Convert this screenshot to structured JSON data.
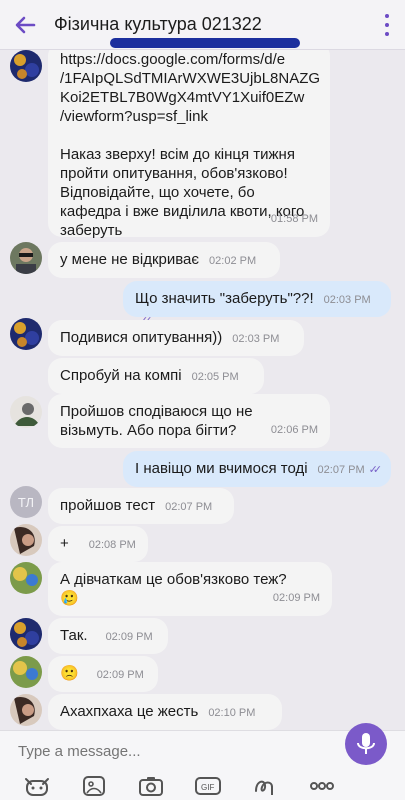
{
  "header": {
    "title": "Фізична культура 021322"
  },
  "messages": [
    {
      "text": "https://docs.google.com/forms/d/e\n/1FAIpQLSdTMIArWXWE3UjbL8NAZG\nKoi2ETBL7B0WgX4mtVY1Xuif0EZw\n/viewform?usp=sf_link\n\nНаказ зверху! всім до кінця тижня\nпройти опитування, обов'язково!\nВідповідайте, що хочете, бо\nкафедра і вже виділила квоти, кого\nзаберуть",
      "time": "01:58 PM"
    },
    {
      "text": "у мене не відкриває",
      "time": "02:02 PM"
    },
    {
      "text": "Що значить \"заберуть\"??!",
      "time": "02:03 PM"
    },
    {
      "text": "Подивися опитування))",
      "time": "02:03 PM"
    },
    {
      "text": "Спробуй на компі",
      "time": "02:05 PM"
    },
    {
      "text": "Пройшов сподіваюся що не\nвізьмуть. Або пора бігти?",
      "time": "02:06 PM"
    },
    {
      "text": "І навіщо ми вчимося тоді",
      "time": "02:07 PM"
    },
    {
      "avatar_initials": "ТЛ",
      "text": "пройшов тест",
      "time": "02:07 PM"
    },
    {
      "text": "+",
      "time": "02:08 PM"
    },
    {
      "text": "А дівчаткам це обов'язково теж?\n🥲",
      "time": "02:09 PM"
    },
    {
      "text": "Так.",
      "time": "02:09 PM"
    },
    {
      "text": "🙁",
      "time": "02:09 PM"
    },
    {
      "text": "Ахахпхаха це жесть",
      "time": "02:10 PM"
    }
  ],
  "composer": {
    "placeholder": "Type a message..."
  },
  "icons": [
    "back-arrow-icon",
    "more-vertical-icon",
    "sticker-icon",
    "sticker-pack-icon",
    "camera-icon",
    "gif-icon",
    "doodle-icon",
    "more-options-icon",
    "microphone-icon"
  ],
  "colors": {
    "accent": "#7b5ac9",
    "outgoing_bubble": "#d9e9fb",
    "incoming_bubble": "#f4f4f4"
  }
}
